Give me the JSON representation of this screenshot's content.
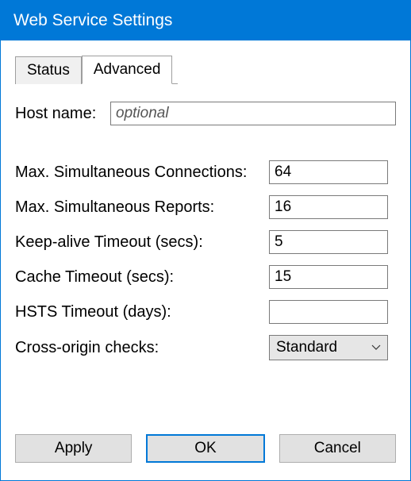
{
  "window": {
    "title": "Web Service Settings"
  },
  "tabs": {
    "status": "Status",
    "advanced": "Advanced"
  },
  "form": {
    "host_name": {
      "label": "Host name:",
      "placeholder": "optional",
      "value": ""
    },
    "max_connections": {
      "label": "Max. Simultaneous Connections:",
      "value": "64"
    },
    "max_reports": {
      "label": "Max. Simultaneous Reports:",
      "value": "16"
    },
    "keepalive_timeout": {
      "label": "Keep-alive Timeout (secs):",
      "value": "5"
    },
    "cache_timeout": {
      "label": "Cache Timeout (secs):",
      "value": "15"
    },
    "hsts_timeout": {
      "label": "HSTS Timeout (days):",
      "value": ""
    },
    "cross_origin": {
      "label": "Cross-origin checks:",
      "value": "Standard"
    }
  },
  "buttons": {
    "apply": "Apply",
    "ok": "OK",
    "cancel": "Cancel"
  }
}
